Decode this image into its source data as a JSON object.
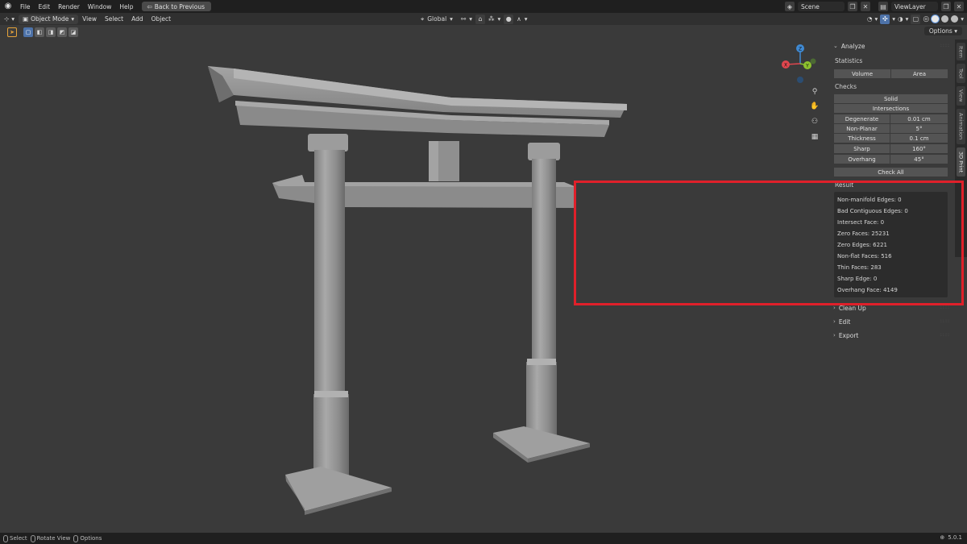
{
  "topbar": {
    "menus": [
      "File",
      "Edit",
      "Render",
      "Window",
      "Help"
    ],
    "back_label": "Back to Previous",
    "scene_label": "Scene",
    "viewlayer_label": "ViewLayer"
  },
  "header": {
    "mode": "Object Mode",
    "menus": [
      "View",
      "Select",
      "Add",
      "Object"
    ],
    "orientation": "Global"
  },
  "options_label": "Options",
  "gizmo": {
    "x": "X",
    "y": "Y",
    "z": "Z"
  },
  "tabs": [
    "Item",
    "Tool",
    "View",
    "Animation",
    "3D Print"
  ],
  "panel": {
    "analyze": {
      "title": "Analyze",
      "statistics_label": "Statistics",
      "volume_label": "Volume",
      "area_label": "Area",
      "checks_label": "Checks",
      "solid_label": "Solid",
      "intersections_label": "Intersections",
      "rows": [
        {
          "key": "Degenerate",
          "value": "0.01 cm"
        },
        {
          "key": "Non-Planar",
          "value": "5°"
        },
        {
          "key": "Thickness",
          "value": "0.1 cm"
        },
        {
          "key": "Sharp",
          "value": "160°"
        },
        {
          "key": "Overhang",
          "value": "45°"
        }
      ],
      "check_all_label": "Check All",
      "result_label": "Result",
      "results": [
        "Non-manifold Edges: 0",
        "Bad Contiguous Edges: 0",
        "Intersect Face: 0",
        "Zero Faces: 25231",
        "Zero Edges: 6221",
        "Non-flat Faces: 516",
        "Thin Faces: 283",
        "Sharp Edge: 0",
        "Overhang Face: 4149"
      ]
    },
    "sections": [
      "Clean Up",
      "Edit",
      "Export"
    ]
  },
  "statusbar": {
    "select": "Select",
    "rotate": "Rotate View",
    "options": "Options",
    "version": "5.0.1"
  },
  "colors": {
    "accent_blue": "#4d72a8",
    "active_tool": "#e5a33a",
    "highlight": "#e0202a",
    "axis_x": "#e0464e",
    "axis_y": "#8dc22e",
    "axis_z": "#3f8ad4"
  }
}
